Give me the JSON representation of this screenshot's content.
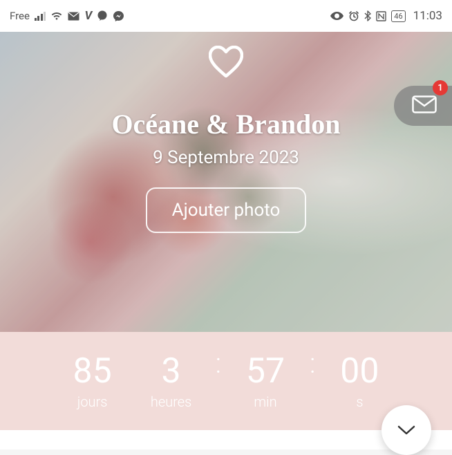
{
  "status": {
    "carrier": "Free",
    "battery": "46",
    "time": "11:03"
  },
  "mail": {
    "badge": "1"
  },
  "hero": {
    "couple_names": "Océane & Brandon",
    "date": "9 Septembre 2023",
    "add_photo_label": "Ajouter photo"
  },
  "countdown": {
    "days": {
      "value": "85",
      "label": "jours"
    },
    "hours": {
      "value": "3",
      "label": "heures"
    },
    "minutes": {
      "value": "57",
      "label": "min"
    },
    "seconds": {
      "value": "00",
      "label": "s"
    }
  }
}
